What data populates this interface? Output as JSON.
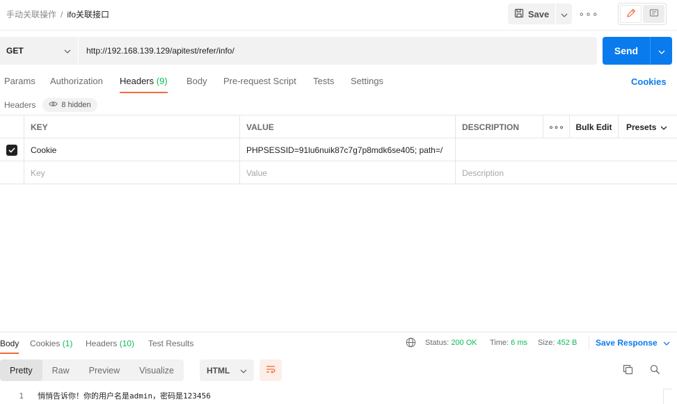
{
  "breadcrumb": {
    "parent": "手动关联操作",
    "separator": "/",
    "current": "ifo关联接口"
  },
  "toolbar": {
    "save_label": "Save",
    "more_label": "∘∘∘"
  },
  "request": {
    "method": "GET",
    "url": "http://192.168.139.129/apitest/refer/info/",
    "send_label": "Send"
  },
  "tabs": [
    {
      "label": "Params",
      "count": ""
    },
    {
      "label": "Authorization",
      "count": ""
    },
    {
      "label": "Headers",
      "count": "(9)"
    },
    {
      "label": "Body",
      "count": ""
    },
    {
      "label": "Pre-request Script",
      "count": ""
    },
    {
      "label": "Tests",
      "count": ""
    },
    {
      "label": "Settings",
      "count": ""
    }
  ],
  "cookies_link": "Cookies",
  "headers_sub": {
    "label": "Headers",
    "hidden": "8 hidden"
  },
  "table": {
    "col_key": "KEY",
    "col_value": "VALUE",
    "col_description": "DESCRIPTION",
    "more": "∘∘∘",
    "bulk_edit": "Bulk Edit",
    "presets": "Presets",
    "rows": [
      {
        "checked": true,
        "key": "Cookie",
        "value": "PHPSESSID=91lu6nuik87c7g7p8mdk6se405; path=/",
        "description": ""
      }
    ],
    "placeholders": {
      "key": "Key",
      "value": "Value",
      "description": "Description"
    }
  },
  "response": {
    "tabs": [
      {
        "label": "Body",
        "count": ""
      },
      {
        "label": "Cookies",
        "count": "(1)"
      },
      {
        "label": "Headers",
        "count": "(10)"
      },
      {
        "label": "Test Results",
        "count": ""
      }
    ],
    "status_label": "Status:",
    "status_value": "200 OK",
    "time_label": "Time:",
    "time_value": "6 ms",
    "size_label": "Size:",
    "size_value": "452 B",
    "save_response": "Save Response",
    "formats": [
      "Pretty",
      "Raw",
      "Preview",
      "Visualize"
    ],
    "language": "HTML",
    "lines": [
      {
        "no": "1",
        "text": "悄悄告诉你！你的用户名是admin，密码是123456"
      }
    ]
  },
  "colors": {
    "accent": "#f26b3a",
    "primary": "#097bed",
    "success": "#0cbb52"
  },
  "icons": [
    "save-icon",
    "chevron-down-icon",
    "edit-icon",
    "comment-icon",
    "eye-icon",
    "check-icon",
    "globe-icon",
    "wrap-lines-icon",
    "copy-icon",
    "search-icon"
  ]
}
